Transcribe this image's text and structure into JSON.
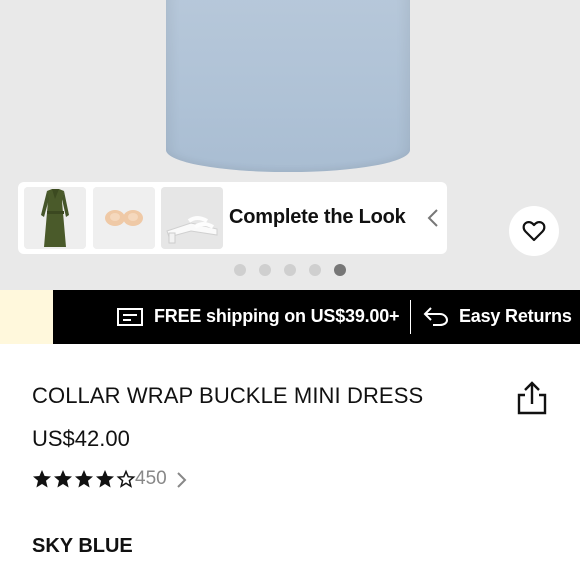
{
  "gallery": {
    "complete_the_look": {
      "label": "Complete the Look",
      "items": [
        {
          "icon": "olive-dress-thumbnail"
        },
        {
          "icon": "nude-pads-thumbnail"
        },
        {
          "icon": "white-sandals-thumbnail"
        }
      ]
    },
    "pagination": {
      "total": 5,
      "active_index": 4
    }
  },
  "promo": {
    "shipping_text": "FREE shipping on US$39.00+",
    "returns_text": "Easy Returns"
  },
  "product": {
    "title": "COLLAR WRAP BUCKLE MINI DRESS",
    "price": "US$42.00",
    "rating": {
      "stars": 4.5,
      "max": 5,
      "count": "450"
    },
    "color_label": "SKY BLUE"
  },
  "colors": {
    "promo_bg": "#000000",
    "promo_left_accent": "#fff8dc",
    "hero_bg": "#e9e9e9",
    "dress_color": "#afc2d6"
  }
}
